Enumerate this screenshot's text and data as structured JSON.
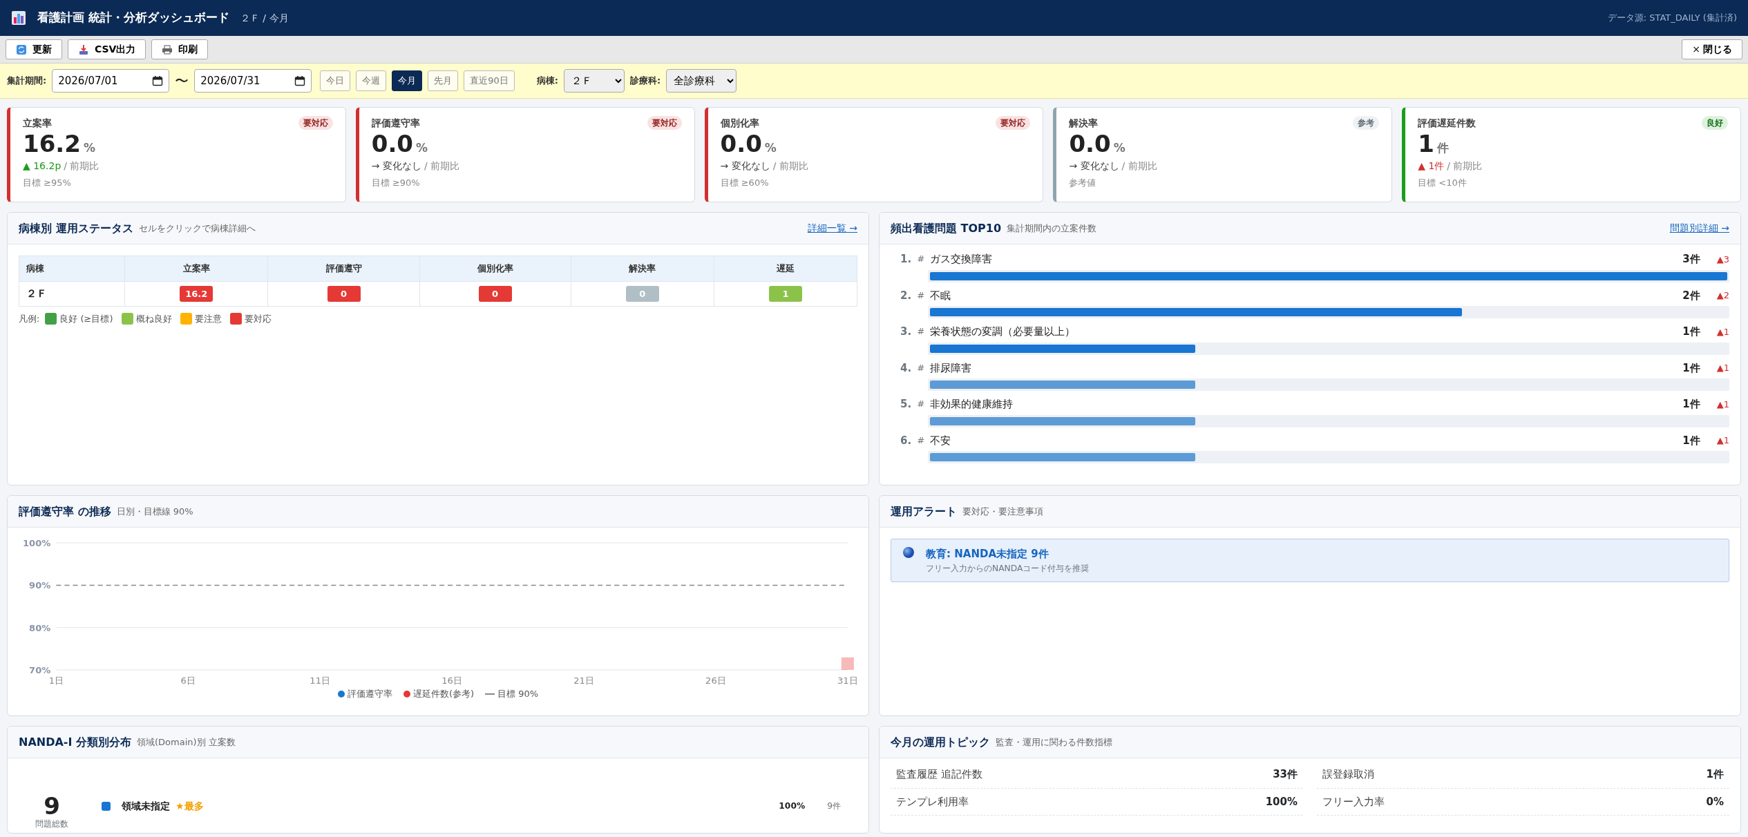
{
  "header": {
    "title": "看護計画 統計・分析ダッシュボード",
    "context": "２Ｆ / 今月",
    "source": "データ源: STAT_DAILY (集計済)"
  },
  "toolbar": {
    "buttons": [
      {
        "kind": "refresh",
        "label": "更新"
      },
      {
        "kind": "csv",
        "label": "CSV出力"
      },
      {
        "kind": "print",
        "label": "印刷"
      }
    ],
    "close": "閉じる",
    "close_icon": "×"
  },
  "filter": {
    "period_label": "集計期間:",
    "from": "2026/07/01",
    "separator": "〜",
    "to": "2026/07/31",
    "ranges": [
      {
        "label": "今日",
        "selected": false
      },
      {
        "label": "今週",
        "selected": false
      },
      {
        "label": "今月",
        "selected": true
      },
      {
        "label": "先月",
        "selected": false
      },
      {
        "label": "直近90日",
        "selected": false
      }
    ],
    "ward_label": "病棟:",
    "ward": "２Ｆ",
    "dept_label": "診療科:",
    "dept": "全診療科"
  },
  "kpis": [
    {
      "label": "立案率",
      "value": "16.2",
      "unit": "%",
      "badge": "要対応",
      "color": "#d32f2f",
      "change": {
        "text": "▲ 16.2p",
        "color": "#1a9e1a"
      },
      "compare": "/ 前期比",
      "note": "目標 ≥95%"
    },
    {
      "label": "評価遵守率",
      "value": "0.0",
      "unit": "%",
      "badge": "要対応",
      "color": "#d32f2f",
      "change": {
        "text": "→ 変化なし",
        "color": "#444444"
      },
      "compare": "/ 前期比",
      "note": "目標 ≥90%"
    },
    {
      "label": "個別化率",
      "value": "0.0",
      "unit": "%",
      "badge": "要対応",
      "color": "#d32f2f",
      "change": {
        "text": "→ 変化なし",
        "color": "#444444"
      },
      "compare": "/ 前期比",
      "note": "目標 ≥60%"
    },
    {
      "label": "解決率",
      "value": "0.0",
      "unit": "%",
      "badge": "参考",
      "color": "#90a4ae",
      "change": {
        "text": "→ 変化なし",
        "color": "#444444"
      },
      "compare": "/ 前期比",
      "note": "参考値"
    },
    {
      "label": "評価遅延件数",
      "value": "1",
      "unit": "件",
      "badge": "良好",
      "color": "#1a9e1a",
      "change": {
        "text": "▲ 1件",
        "color": "#d32f2f"
      },
      "compare": "/ 前期比",
      "note": "目標 <10件"
    }
  ],
  "ward_status": {
    "title": "病棟別 運用ステータス",
    "subtitle": "セルをクリックで病棟詳細へ",
    "link": "詳細一覧 →",
    "columns": [
      "病棟",
      "立案率",
      "評価遵守",
      "個別化率",
      "解決率",
      "遅延"
    ],
    "rows": [
      {
        "cells": [
          {
            "value": "２Ｆ"
          },
          {
            "value": "16.2",
            "color": "#e53935"
          },
          {
            "value": "0",
            "color": "#e53935"
          },
          {
            "value": "0",
            "color": "#e53935"
          },
          {
            "value": "0",
            "color": "#b0bec5"
          },
          {
            "value": "1",
            "color": "#8bc34a"
          }
        ]
      }
    ],
    "legend_label": "凡例:",
    "legend": [
      {
        "label": "良好 (≥目標)",
        "color": "#43a047"
      },
      {
        "label": "概ね良好",
        "color": "#8bc34a"
      },
      {
        "label": "要注意",
        "color": "#ffb300"
      },
      {
        "label": "要対応",
        "color": "#e53935"
      }
    ]
  },
  "top_problems": {
    "title": "頻出看護問題 TOP10",
    "subtitle": "集計期間内の立案件数",
    "link": "問題別詳細 →",
    "items": [
      {
        "rank": "1.",
        "mark": "#",
        "name": "ガス交換障害",
        "count": "3件",
        "delta": "▲3",
        "level": 1,
        "color": "#1976d2"
      },
      {
        "rank": "2.",
        "mark": "#",
        "name": "不眠",
        "count": "2件",
        "delta": "▲2",
        "level": 0.667,
        "color": "#1976d2"
      },
      {
        "rank": "3.",
        "mark": "#",
        "name": "栄養状態の変調（必要量以上）",
        "count": "1件",
        "delta": "▲1",
        "level": 0.333,
        "color": "#1976d2"
      },
      {
        "rank": "4.",
        "mark": "#",
        "name": "排尿障害",
        "count": "1件",
        "delta": "▲1",
        "level": 0.333,
        "color": "#5c9bd5"
      },
      {
        "rank": "5.",
        "mark": "#",
        "name": "非効果的健康維持",
        "count": "1件",
        "delta": "▲1",
        "level": 0.333,
        "color": "#5c9bd5"
      },
      {
        "rank": "6.",
        "mark": "#",
        "name": "不安",
        "count": "1件",
        "delta": "▲1",
        "level": 0.333,
        "color": "#5c9bd5"
      }
    ]
  },
  "trend": {
    "title": "評価遵守率 の推移",
    "subtitle": "日別・目標線 90%",
    "legend": [
      {
        "name": "評価遵守率",
        "color": "#1976d2"
      },
      {
        "name": "遅延件数(参考)",
        "color": "#e53935"
      }
    ],
    "chart_data": {
      "type": "line",
      "x": [
        1,
        31
      ],
      "series": [
        {
          "name": "目標 90%",
          "color": "#888888",
          "line_style": "dashed",
          "values": [
            90,
            90
          ]
        }
      ],
      "xlim": [
        1,
        31
      ],
      "ylim": [
        70,
        100
      ],
      "yticks": [
        {
          "value": 100,
          "label": "100%"
        },
        {
          "value": 90,
          "label": "90%"
        },
        {
          "value": 80,
          "label": "80%"
        },
        {
          "value": 70,
          "label": "70%"
        }
      ],
      "xticks": [
        {
          "value": 1,
          "label": "1日"
        },
        {
          "value": 6,
          "label": "6日"
        },
        {
          "value": 11,
          "label": "11日"
        },
        {
          "value": 16,
          "label": "16日"
        },
        {
          "value": 21,
          "label": "21日"
        },
        {
          "value": 26,
          "label": "26日"
        },
        {
          "value": 31,
          "label": "31日"
        }
      ]
    }
  },
  "alerts": {
    "title": "運用アラート",
    "subtitle": "要対応・要注意事項",
    "items": [
      {
        "title": "教育: NANDA未指定 9件",
        "text": "フリー入力からのNANDAコード付与を推奨"
      }
    ]
  },
  "nanda": {
    "title": "NANDA-I 分類別分布",
    "subtitle": "領域(Domain)別 立案数",
    "total": "9",
    "total_label": "問題総数",
    "items": [
      {
        "name": "領域未指定",
        "tag": "★最多",
        "percent": "100%",
        "count": "9件",
        "color": "#1976d2"
      }
    ]
  },
  "topics": {
    "title": "今月の運用トピック",
    "subtitle": "監査・運用に関わる件数指標",
    "items": [
      {
        "label": "監査履歴 追記件数",
        "value": "33件"
      },
      {
        "label": "誤登録取消",
        "value": "1件"
      },
      {
        "label": "テンプレ利用率",
        "value": "100%"
      },
      {
        "label": "フリー入力率",
        "value": "0%"
      }
    ]
  }
}
